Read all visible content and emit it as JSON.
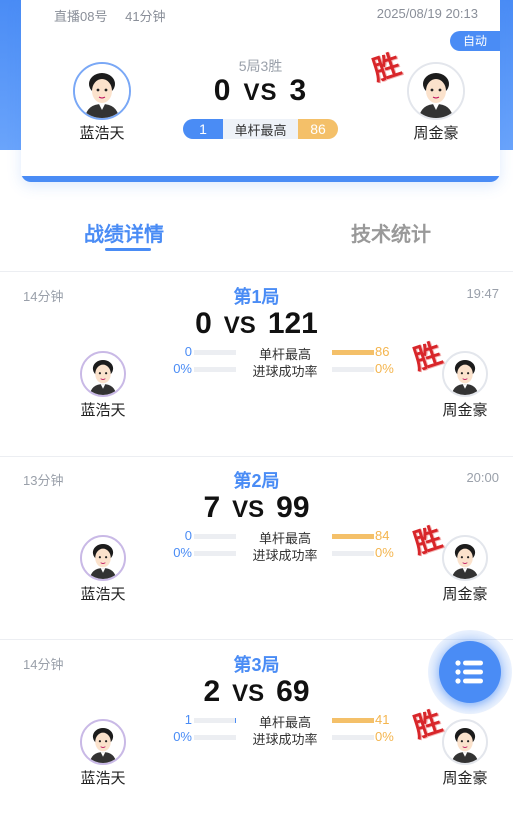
{
  "match": {
    "room": "直播08号",
    "duration": "41分钟",
    "datetime": "2025/08/19 20:13",
    "mode_badge": "自动",
    "rule": "5局3胜",
    "score_left": "0",
    "vs": "VS",
    "score_right": "3",
    "high_break_label": "单杆最高",
    "high_break_left": "1",
    "high_break_right": "86",
    "player_left": "蓝浩天",
    "player_right": "周金豪",
    "win_stamp": "胜"
  },
  "tabs": [
    {
      "label": "战绩详情",
      "active": true
    },
    {
      "label": "技术统计",
      "active": false
    }
  ],
  "games": [
    {
      "duration": "14分钟",
      "time": "19:47",
      "title": "第1局",
      "score_left": "0",
      "vs": "VS",
      "score_right": "121",
      "stat1_label": "单杆最高",
      "stat1_left": "0",
      "stat1_right": "86",
      "stat1_left_fill": 0,
      "stat1_right_fill": 1.0,
      "stat2_label": "进球成功率",
      "stat2_left": "0%",
      "stat2_right": "0%",
      "stat2_left_fill": 0,
      "stat2_right_fill": 0,
      "player_left": "蓝浩天",
      "player_right": "周金豪",
      "win_stamp": "胜"
    },
    {
      "duration": "13分钟",
      "time": "20:00",
      "title": "第2局",
      "score_left": "7",
      "vs": "VS",
      "score_right": "99",
      "stat1_label": "单杆最高",
      "stat1_left": "0",
      "stat1_right": "84",
      "stat1_left_fill": 0,
      "stat1_right_fill": 1.0,
      "stat2_label": "进球成功率",
      "stat2_left": "0%",
      "stat2_right": "0%",
      "stat2_left_fill": 0,
      "stat2_right_fill": 0,
      "player_left": "蓝浩天",
      "player_right": "周金豪",
      "win_stamp": "胜"
    },
    {
      "duration": "14分钟",
      "time": "",
      "title": "第3局",
      "score_left": "2",
      "vs": "VS",
      "score_right": "69",
      "stat1_label": "单杆最高",
      "stat1_left": "1",
      "stat1_right": "41",
      "stat1_left_fill": 0.02,
      "stat1_right_fill": 1.0,
      "stat2_label": "进球成功率",
      "stat2_left": "0%",
      "stat2_right": "0%",
      "stat2_left_fill": 0,
      "stat2_right_fill": 0,
      "player_left": "蓝浩天",
      "player_right": "周金豪",
      "win_stamp": "胜"
    }
  ],
  "fab_icon": "list-icon",
  "colors": {
    "accent": "#4a8cf5",
    "gold": "#f4c069",
    "win": "#d8262a"
  }
}
